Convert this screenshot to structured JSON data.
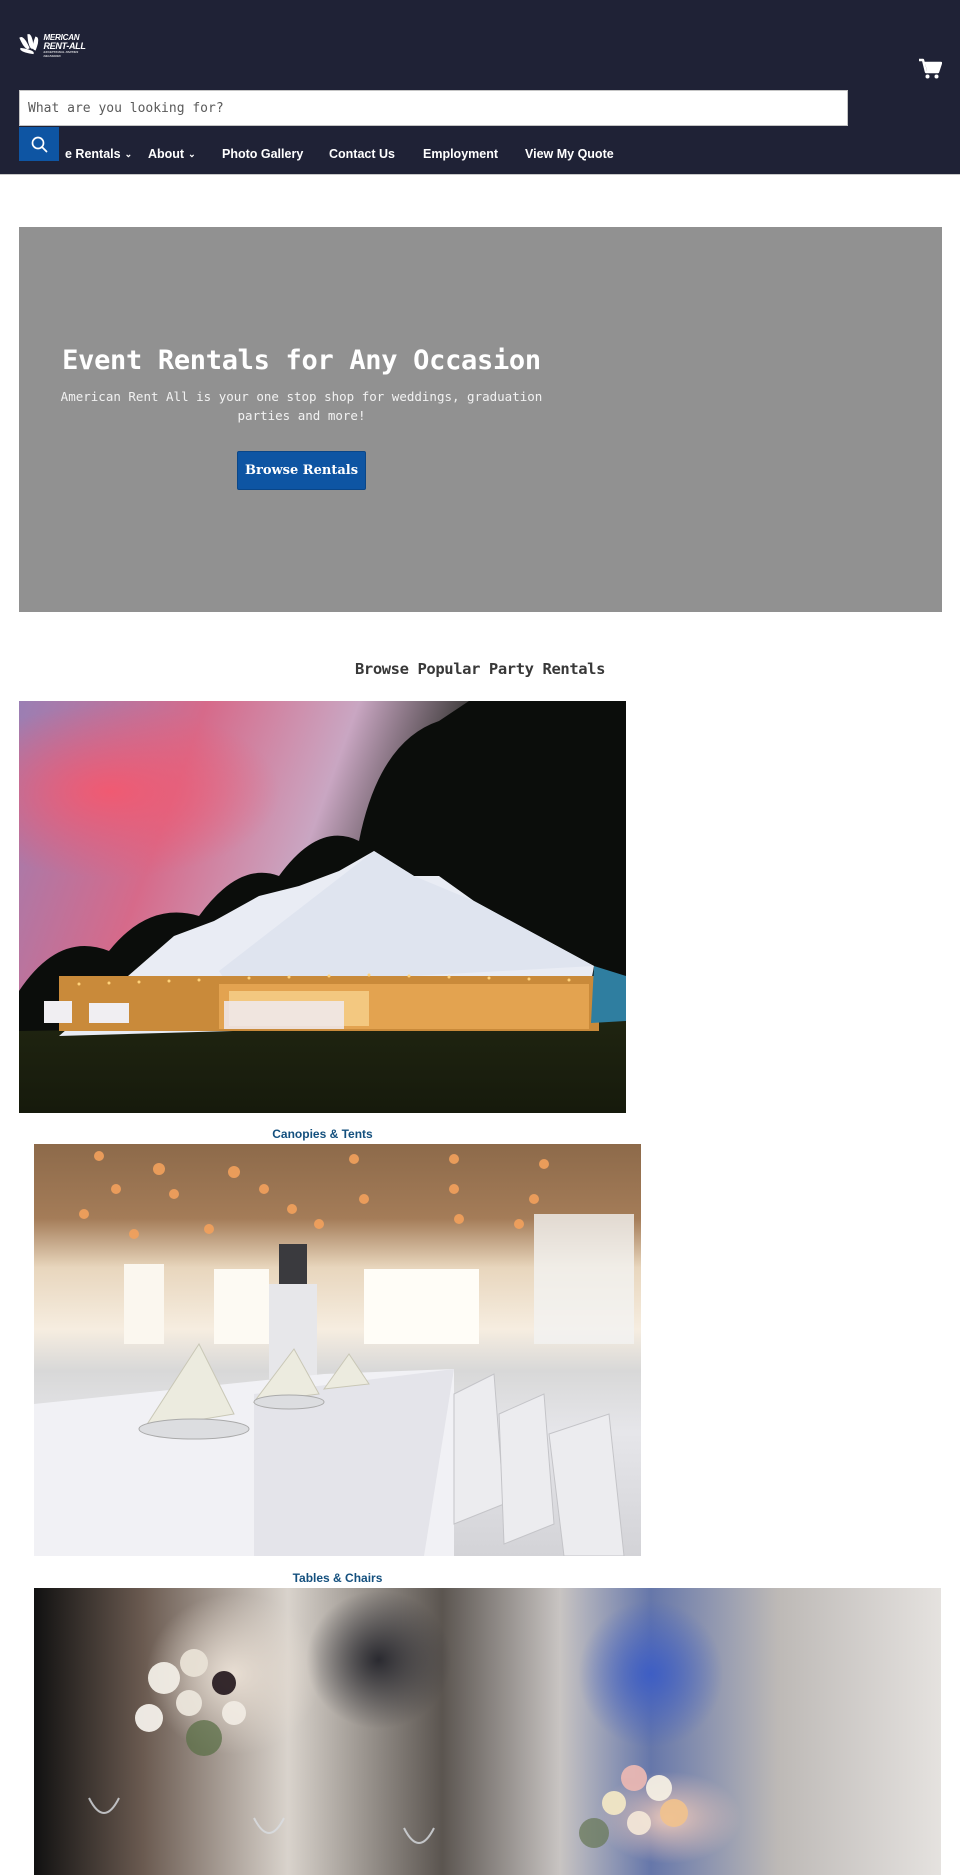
{
  "header": {
    "logo": {
      "line1": "MERICAN",
      "line2": "RENT-ALL",
      "tagline": "EXCEPTIONAL PARTIES DELIVERED",
      "alt": "American Rent-All"
    },
    "search": {
      "placeholder": "What are you looking for?",
      "value": "",
      "button_icon": "search-icon"
    },
    "cart_icon": "cart-icon",
    "nav": [
      {
        "label": "Browse Rentals",
        "visible_label": "e Rentals",
        "has_dropdown": true
      },
      {
        "label": "About",
        "has_dropdown": true
      },
      {
        "label": "Photo Gallery",
        "has_dropdown": false
      },
      {
        "label": "Contact Us",
        "has_dropdown": false
      },
      {
        "label": "Employment",
        "has_dropdown": false
      },
      {
        "label": "View My Quote",
        "has_dropdown": false
      }
    ],
    "chevron": "⌄"
  },
  "hero": {
    "title": "Event Rentals for Any Occasion",
    "subtitle": "American Rent All is your one stop shop for weddings, graduation parties and more!",
    "button_label": "Browse Rentals"
  },
  "popular": {
    "title": "Browse Popular Party Rentals",
    "items": [
      {
        "label": "Canopies & Tents",
        "image": "tent-at-dusk-photo"
      },
      {
        "label": "Tables & Chairs",
        "image": "banquet-table-photo"
      },
      {
        "label": "",
        "image": "reception-centerpieces-photo"
      }
    ]
  },
  "colors": {
    "header_bg": "#1f2236",
    "accent_blue": "#0e55a3",
    "hero_bg": "#919191",
    "link_blue": "#14507e"
  }
}
